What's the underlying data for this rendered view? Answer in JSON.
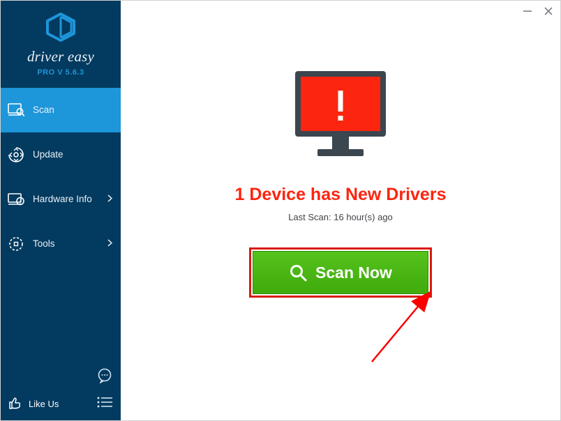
{
  "app": {
    "logo_text": "driver easy",
    "version": "PRO V 5.6.3"
  },
  "sidebar": {
    "items": [
      {
        "label": "Scan",
        "has_chevron": false,
        "active": true
      },
      {
        "label": "Update",
        "has_chevron": false,
        "active": false
      },
      {
        "label": "Hardware Info",
        "has_chevron": true,
        "active": false
      },
      {
        "label": "Tools",
        "has_chevron": true,
        "active": false
      }
    ],
    "like_label": "Like Us"
  },
  "main": {
    "headline": "1 Device has New Drivers",
    "last_scan": "Last Scan: 16 hour(s) ago",
    "scan_button": "Scan Now"
  },
  "colors": {
    "sidebar_bg": "#033a5f",
    "active_bg": "#1d96da",
    "alert_red": "#fb2510",
    "scan_green": "#49b615",
    "highlight_border": "#d81a0b"
  }
}
